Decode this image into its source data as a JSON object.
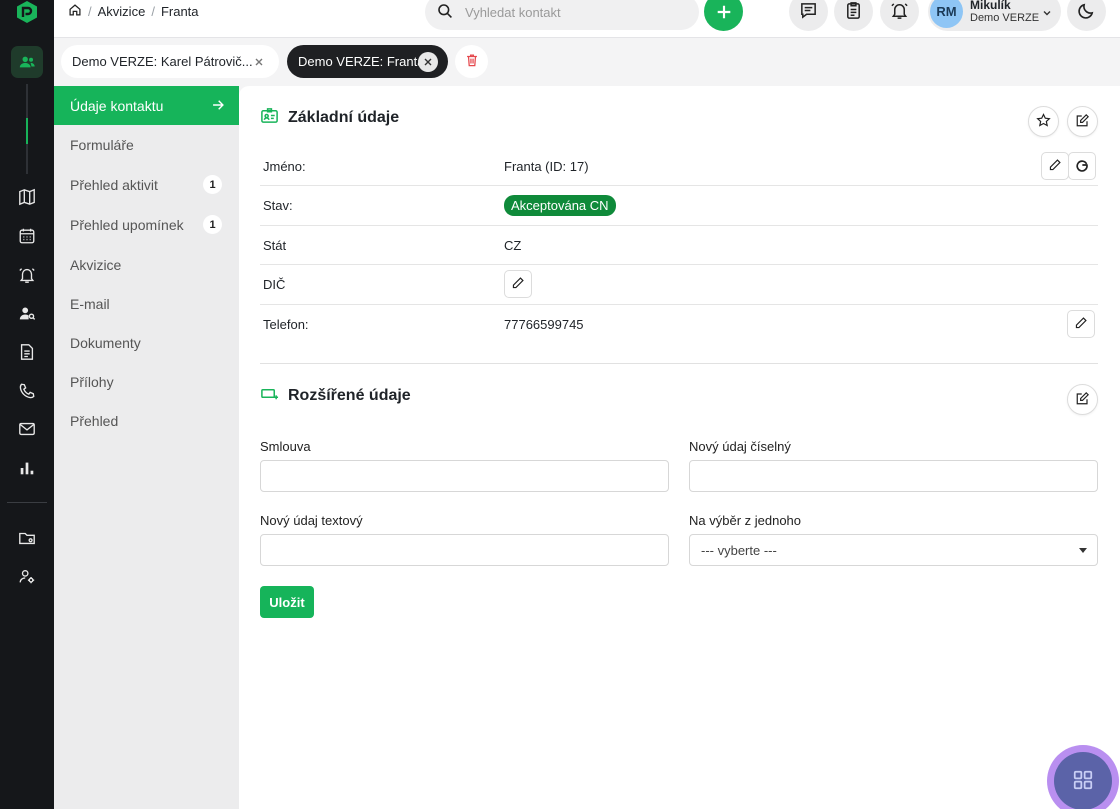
{
  "breadcrumb": {
    "item1": "Akvizice",
    "item2": "Franta"
  },
  "search": {
    "placeholder": "Vyhledat kontakt"
  },
  "user": {
    "initials": "RM",
    "name": "Mikulík",
    "org": "Demo VERZE"
  },
  "tabs": [
    {
      "label": "Demo VERZE: Karel Pátrovič..."
    },
    {
      "label": "Demo VERZE: Franta"
    }
  ],
  "menu": {
    "items": [
      {
        "label": "Údaje kontaktu"
      },
      {
        "label": "Formuláře"
      },
      {
        "label": "Přehled aktivit",
        "badge": "1"
      },
      {
        "label": "Přehled upomínek",
        "badge": "1"
      },
      {
        "label": "Akvizice"
      },
      {
        "label": "E-mail"
      },
      {
        "label": "Dokumenty"
      },
      {
        "label": "Přílohy"
      },
      {
        "label": "Přehled"
      }
    ]
  },
  "basic": {
    "title": "Základní údaje",
    "rows": [
      {
        "label": "Jméno:",
        "value": "Franta (ID: 17)"
      },
      {
        "label": "Stav:",
        "value": "Akceptována CN"
      },
      {
        "label": "Stát",
        "value": "CZ"
      },
      {
        "label": "DIČ",
        "value": ""
      },
      {
        "label": "Telefon:",
        "value": "77766599745"
      }
    ]
  },
  "extended": {
    "title": "Rozšířené údaje",
    "fields": {
      "smlouva": {
        "label": "Smlouva",
        "value": ""
      },
      "ciselny": {
        "label": "Nový údaj číselný",
        "value": ""
      },
      "textovy": {
        "label": "Nový údaj textový",
        "value": ""
      },
      "vyber": {
        "label": "Na výběr z jednoho",
        "selected": "--- vyberte ---"
      }
    },
    "save_label": "Uložit"
  },
  "colors": {
    "brand": "#16b45a",
    "status_pill": "#0f8a3a",
    "rail": "#15171a"
  }
}
